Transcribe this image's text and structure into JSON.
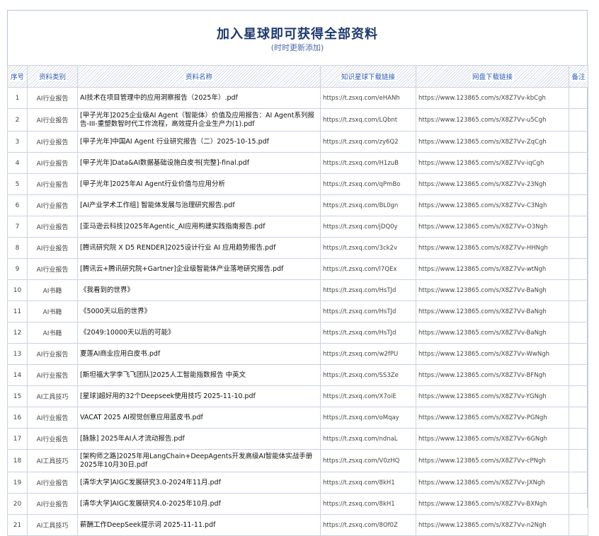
{
  "title": "加入星球即可获得全部资料",
  "subtitle": "(时时更新添加)",
  "columns": {
    "index": "序号",
    "category": "资料类别",
    "name": "资料名称",
    "zsxq_url": "知识星球下载链接",
    "pan_url": "网盘下载链接",
    "note": "备注"
  },
  "rows": [
    {
      "index": "1",
      "category": "AI行业报告",
      "name": "AI技术在项目管理中的应用洞察报告（2025年）.pdf",
      "zsxq_url": "https://t.zsxq.com/eHANh",
      "pan_url": "https://www.123865.com/s/X8Z7Vv-kbCgh"
    },
    {
      "index": "2",
      "category": "AI行业报告",
      "name": "[甲子光年]2025企业级AI Agent（智能体）价值及应用报告：AI Agent系列报告-III-重塑数智时代工作流程，高效提升企业生产力(1).pdf",
      "zsxq_url": "https://t.zsxq.com/LQbnt",
      "pan_url": "https://www.123865.com/s/X8Z7Vv-u5Cgh"
    },
    {
      "index": "3",
      "category": "AI行业报告",
      "name": "[甲子光年]中国AI Agent 行业研究报告（二）2025-10-15.pdf",
      "zsxq_url": "https://t.zsxq.com/zy6Q2",
      "pan_url": "https://www.123865.com/s/X8Z7Vv-ZqCgh"
    },
    {
      "index": "4",
      "category": "AI行业报告",
      "name": "[甲子光年]Data&AI数据基础设施白皮书[完整]-final.pdf",
      "zsxq_url": "https://t.zsxq.com/H1zuB",
      "pan_url": "https://www.123865.com/s/X8Z7Vv-iqCgh"
    },
    {
      "index": "5",
      "category": "AI行业报告",
      "name": "[甲子光年]2025年AI Agent行业价值与应用分析",
      "zsxq_url": "https://t.zsxq.com/qPmBo",
      "pan_url": "https://www.123865.com/s/X8Z7Vv-23Ngh"
    },
    {
      "index": "6",
      "category": "AI行业报告",
      "name": "[AI产业学术工作组] 智能体发展与治理研究报告.pdf",
      "zsxq_url": "https://t.zsxq.com/BL0gn",
      "pan_url": "https://www.123865.com/s/X8Z7Vv-C3Ngh"
    },
    {
      "index": "7",
      "category": "AI行业报告",
      "name": "[亚马逊云科技]2025年Agentic_AI应用构建实践指南报告.pdf",
      "zsxq_url": "https://t.zsxq.com/jDQ0y",
      "pan_url": "https://www.123865.com/s/X8Z7Vv-O3Ngh"
    },
    {
      "index": "8",
      "category": "AI行业报告",
      "name": "[腾讯研究院 X D5 RENDER]2025设计行业 AI 应用趋势报告.pdf",
      "zsxq_url": "https://t.zsxq.com/3ck2v",
      "pan_url": "https://www.123865.com/s/X8Z7Vv-HHNgh"
    },
    {
      "index": "9",
      "category": "AI行业报告",
      "name": "[腾讯云+腾讯研究院+Gartner]企业级智能体产业落地研究报告.pdf",
      "zsxq_url": "https://t.zsxq.com/l7QEx",
      "pan_url": "https://www.123865.com/s/X8Z7Vv-wtNgh"
    },
    {
      "index": "10",
      "category": "AI书籍",
      "name": "《我看到的世界》",
      "zsxq_url": "https://t.zsxq.com/HsTJd",
      "pan_url": "https://www.123865.com/s/X8Z7Vv-BaNgh"
    },
    {
      "index": "11",
      "category": "AI书籍",
      "name": "《5000天以后的世界》",
      "zsxq_url": "https://t.zsxq.com/HsTJd",
      "pan_url": "https://www.123865.com/s/X8Z7Vv-BaNgh"
    },
    {
      "index": "12",
      "category": "AI书籍",
      "name": "《2049:10000天以后的可能》",
      "zsxq_url": "https://t.zsxq.com/HsTJd",
      "pan_url": "https://www.123865.com/s/X8Z7Vv-BaNgh"
    },
    {
      "index": "13",
      "category": "AI行业报告",
      "name": "夏莲AI商业应用白皮书.pdf",
      "zsxq_url": "https://t.zsxq.com/w2fPU",
      "pan_url": "https://www.123865.com/s/X8Z7Vv-WwNgh"
    },
    {
      "index": "14",
      "category": "AI行业报告",
      "name": "[斯坦福大学李飞飞团队]2025人工智能指数报告 中英文",
      "zsxq_url": "https://t.zsxq.com/SS3Ze",
      "pan_url": "https://www.123865.com/s/X8Z7Vv-BFNgh"
    },
    {
      "index": "15",
      "category": "AI工具技巧",
      "name": "[星球]超好用的32个Deepseek使用技巧 2025-11-10.pdf",
      "zsxq_url": "https://t.zsxq.com/X7oiE",
      "pan_url": "https://www.123865.com/s/X8Z7Vv-YGNgh"
    },
    {
      "index": "16",
      "category": "AI行业报告",
      "name": "VACAT 2025 AI视觉创意应用蓝皮书.pdf",
      "zsxq_url": "https://t.zsxq.com/oMqay",
      "pan_url": "https://www.123865.com/s/X8Z7Vv-PGNgh"
    },
    {
      "index": "17",
      "category": "AI行业报告",
      "name": "[脉脉] 2025年AI人才流动报告.pdf",
      "zsxq_url": "https://t.zsxq.com/ndnaL",
      "pan_url": "https://www.123865.com/s/X8Z7Vv-6GNgh"
    },
    {
      "index": "18",
      "category": "AI工具技巧",
      "name": "[架构师之路]2025年用LangChain+DeepAgents开发高级AI智能体实战手册2025年10月30日.pdf",
      "zsxq_url": "https://t.zsxq.com/V0zHQ",
      "pan_url": "https://www.123865.com/s/X8Z7Vv-cPNgh"
    },
    {
      "index": "19",
      "category": "AI行业报告",
      "name": "[清华大学]AIGC发展研究3.0-2024年11月.pdf",
      "zsxq_url": "https://t.zsxq.com/8kH1",
      "pan_url": "https://www.123865.com/s/X8Z7Vv-JXNgh"
    },
    {
      "index": "20",
      "category": "AI行业报告",
      "name": "[清华大学]AIGC发展研究4.0-2025年10月.pdf",
      "zsxq_url": "https://t.zsxq.com/8kH1",
      "pan_url": "https://www.123865.com/s/X8Z7Vv-BXNgh"
    },
    {
      "index": "21",
      "category": "AI工具技巧",
      "name": "薪酬工作DeepSeek提示词 2025-11-11.pdf",
      "zsxq_url": "https://t.zsxq.com/8Of0Z",
      "pan_url": "https://www.123865.com/s/X8Z7Vv-n2Ngh"
    }
  ]
}
